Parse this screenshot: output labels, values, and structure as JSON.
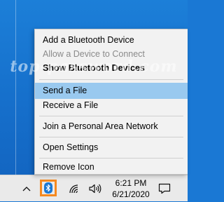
{
  "watermark": "top-password.com",
  "context_menu": {
    "items": [
      {
        "label": "Add a Bluetooth Device",
        "state": "normal"
      },
      {
        "label": "Allow a Device to Connect",
        "state": "disabled"
      },
      {
        "label": "Show Bluetooth Devices",
        "state": "bold"
      },
      {
        "label": "Send a File",
        "state": "highlighted"
      },
      {
        "label": "Receive a File",
        "state": "normal"
      },
      {
        "label": "Join a Personal Area Network",
        "state": "normal"
      },
      {
        "label": "Open Settings",
        "state": "normal"
      },
      {
        "label": "Remove Icon",
        "state": "normal"
      }
    ]
  },
  "taskbar": {
    "icons": [
      "chevron-up-icon",
      "bluetooth-icon",
      "wifi-icon",
      "volume-icon",
      "notification-icon"
    ],
    "clock": {
      "time": "6:21 PM",
      "date": "6/21/2020"
    }
  },
  "colors": {
    "desktop": "#1670cc",
    "menu_bg": "#f2f2f2",
    "menu_highlight": "#99c9ef",
    "taskbar_bg": "#eaeaea",
    "bluetooth_blue": "#1a78d4",
    "highlight_box": "#f5891f"
  }
}
